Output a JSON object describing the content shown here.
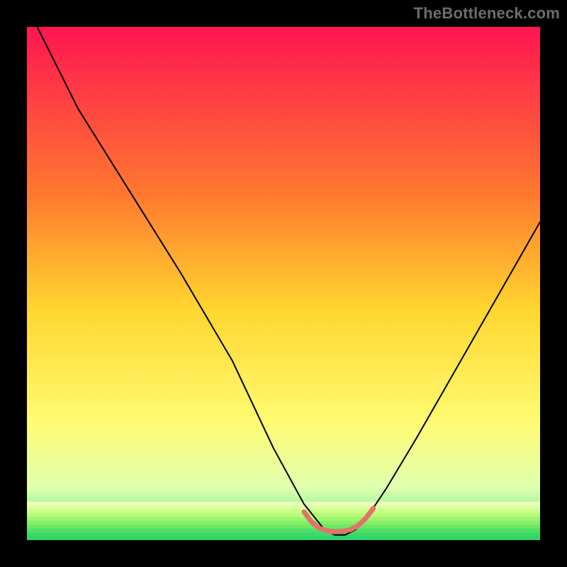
{
  "watermark": "TheBottleneck.com",
  "chart_data": {
    "type": "line",
    "title": "",
    "xlabel": "",
    "ylabel": "",
    "xlim": [
      0,
      100
    ],
    "ylim": [
      0,
      100
    ],
    "background_gradient": {
      "stops": [
        {
          "offset": 0,
          "color": "#ff1551"
        },
        {
          "offset": 33,
          "color": "#ff7a2f"
        },
        {
          "offset": 55,
          "color": "#ffd62f"
        },
        {
          "offset": 77,
          "color": "#fffb72"
        },
        {
          "offset": 90,
          "color": "#dfffb0"
        },
        {
          "offset": 100,
          "color": "#30e56b"
        }
      ]
    },
    "series": [
      {
        "name": "bottleneck-curve",
        "color": "#000000",
        "width": 2,
        "x": [
          2,
          10,
          20,
          30,
          40,
          48,
          54,
          58,
          60,
          62,
          64,
          66,
          70,
          76,
          84,
          92,
          100
        ],
        "y": [
          100,
          84,
          68,
          52,
          35,
          18,
          7,
          2,
          1,
          1,
          2,
          4,
          10,
          20,
          34,
          48,
          62
        ]
      },
      {
        "name": "optimal-range-marker",
        "color": "#e2736b",
        "width": 7,
        "linecap": "round",
        "x": [
          54,
          55.5,
          57,
          58.5,
          60,
          61.5,
          63,
          64.5,
          66,
          67.5
        ],
        "y": [
          5.5,
          3.5,
          2.3,
          1.8,
          1.6,
          1.7,
          2.0,
          2.8,
          4.2,
          6.2
        ]
      }
    ],
    "green_band": {
      "top": 92.5,
      "stripes": [
        "#e9ffba",
        "#dcff9f",
        "#caff86",
        "#b6fb77",
        "#9ff46d",
        "#86ee67",
        "#6de764",
        "#50e066",
        "#3cd968",
        "#30d56a"
      ]
    }
  }
}
